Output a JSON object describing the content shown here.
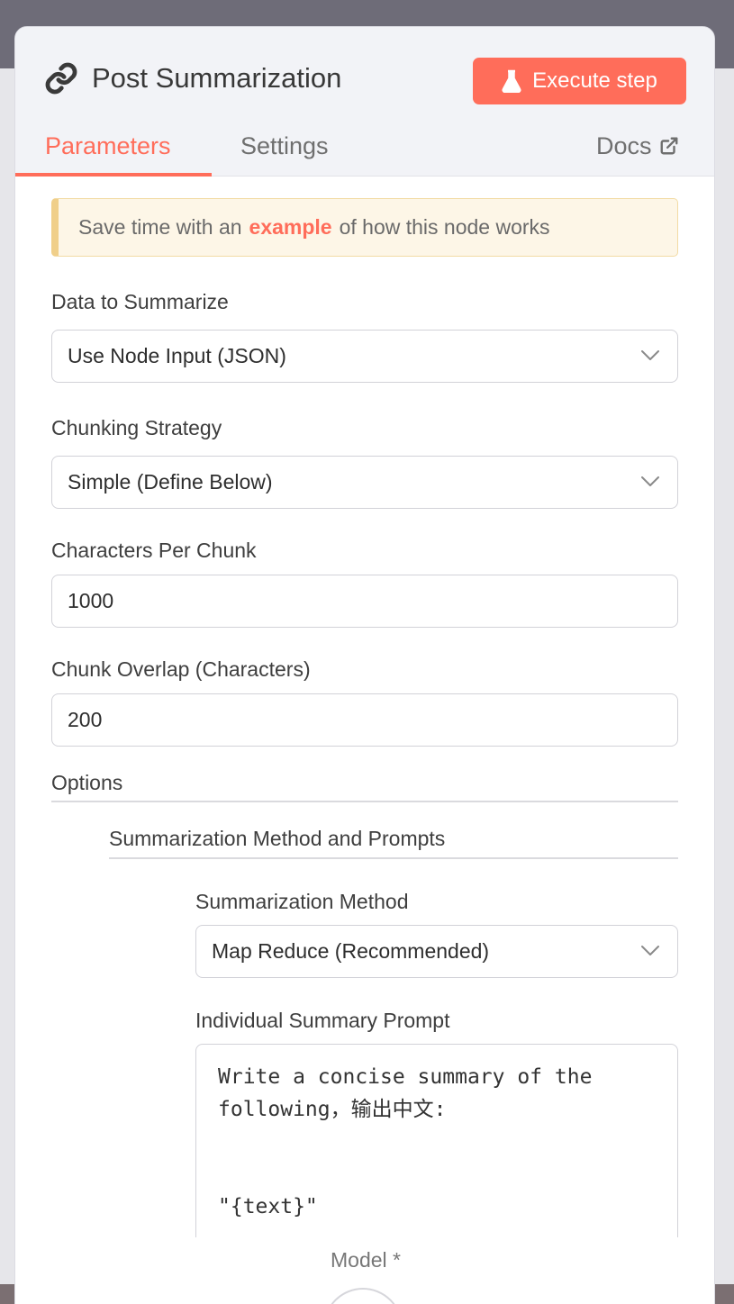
{
  "node": {
    "title": "Post Summarization",
    "execute_label": "Execute step"
  },
  "tabs": {
    "parameters": "Parameters",
    "settings": "Settings",
    "docs": "Docs"
  },
  "notice": {
    "prefix": "Save time with an",
    "link": "example",
    "suffix": "of how this node works"
  },
  "fields": {
    "data_to_summarize": {
      "label": "Data to Summarize",
      "value": "Use Node Input (JSON)"
    },
    "chunking_strategy": {
      "label": "Chunking Strategy",
      "value": "Simple (Define Below)"
    },
    "chars_per_chunk": {
      "label": "Characters Per Chunk",
      "value": "1000"
    },
    "chunk_overlap": {
      "label": "Chunk Overlap (Characters)",
      "value": "200"
    }
  },
  "options": {
    "title": "Options",
    "group_title": "Summarization Method and Prompts",
    "method": {
      "label": "Summarization Method",
      "value": "Map Reduce (Recommended)"
    },
    "individual_prompt": {
      "label": "Individual Summary Prompt",
      "value": "Write a concise summary of the\nfollowing，输出中文:\n\n\n\"{text}\""
    }
  },
  "model": {
    "label": "Model *"
  },
  "colors": {
    "accent": "#ff6d5a",
    "notice_bg": "#fdf6e7"
  }
}
